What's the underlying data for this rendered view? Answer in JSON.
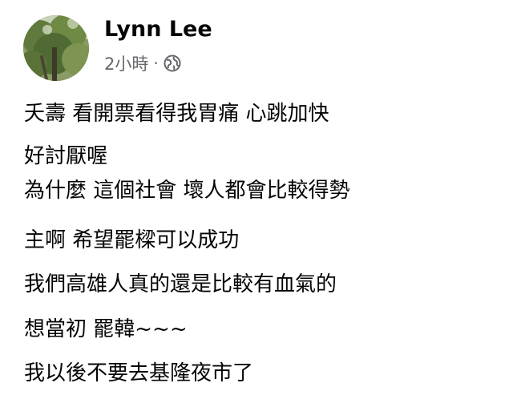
{
  "post": {
    "author": {
      "name": "Lynn Lee",
      "avatar_icon": "avatar-photo"
    },
    "timestamp": "2小時",
    "separator": "·",
    "audience_icon": "globe-icon",
    "message_lines": [
      "夭壽  看開票看得我胃痛  心跳加快",
      "好討厭喔",
      "為什麼  這個社會  壞人都會比較得勢",
      "主啊  希望罷樑可以成功",
      "我們高雄人真的還是比較有血氣的",
      "想當初 罷韓~~~",
      "我以後不要去基隆夜市了"
    ]
  },
  "colors": {
    "text_primary": "#050505",
    "text_secondary": "#65676b",
    "background": "#ffffff"
  }
}
